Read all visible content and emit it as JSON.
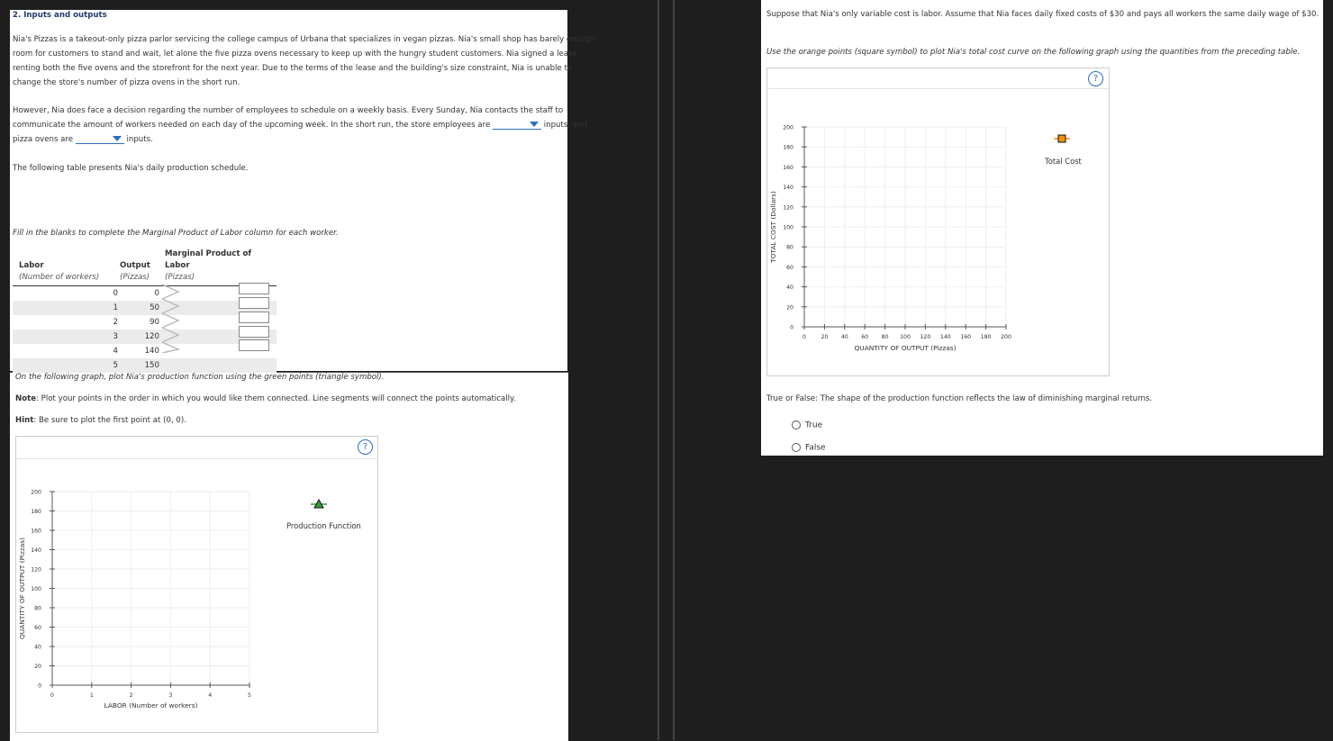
{
  "left": {
    "heading": "2. Inputs and outputs",
    "para1_lines": [
      "Nia's Pizzas is a takeout-only pizza parlor servicing the college campus of Urbana that specializes in vegan pizzas. Nia's small shop has barely enough",
      "room for customers to stand and wait, let alone the five pizza ovens necessary to keep up with the hungry student customers. Nia signed a lease",
      "renting both the five ovens and the storefront for the next year. Due to the terms of the lease and the building's size constraint, Nia is unable to",
      "change the store's number of pizza ovens in the short run."
    ],
    "para2_line1": "However, Nia does face a decision regarding the number of employees to schedule on a weekly basis. Every Sunday, Nia contacts the staff to",
    "para2_line2_a": "communicate the amount of workers needed on each day of the upcoming week. In the short run, the store employees are",
    "para2_line2_b": "inputs, and",
    "para2_line3_a": "pizza ovens are",
    "para2_line3_b": "inputs.",
    "para3": "The following table presents Nia's daily production schedule.",
    "fill_instruction": "Fill in the blanks to complete the Marginal Product of Labor column for each worker.",
    "table": {
      "headers": [
        {
          "line1": "Labor",
          "line2": "(Number of workers)"
        },
        {
          "line1": "Output",
          "line2": "(Pizzas)"
        },
        {
          "line1": "Marginal Product of Labor",
          "line2": "(Pizzas)"
        }
      ],
      "rows": [
        {
          "labor": "0",
          "output": "0"
        },
        {
          "labor": "1",
          "output": "50"
        },
        {
          "labor": "2",
          "output": "90"
        },
        {
          "labor": "3",
          "output": "120"
        },
        {
          "labor": "4",
          "output": "140"
        },
        {
          "labor": "5",
          "output": "150"
        }
      ]
    },
    "graph_instruction": "On the following graph, plot Nia's production function using the green points (triangle symbol).",
    "note_label": "Note",
    "note_text": ": Plot your points in the order in which you would like them connected. Line segments will connect the points automatically.",
    "hint_label": "Hint",
    "hint_text": ": Be sure to plot the first point at (0, 0).",
    "help_symbol": "?",
    "legend_label": "Production Function"
  },
  "right": {
    "para1": "Suppose that Nia's only variable cost is labor. Assume that Nia faces daily fixed costs of $30 and pays all workers the same daily wage of $30.",
    "para2": "Use the orange points (square symbol) to plot Nia's total cost curve on the following graph using the quantities from the preceding table.",
    "help_symbol": "?",
    "legend_label": "Total Cost",
    "question": "True or False: The shape of the production function reflects the law of diminishing marginal returns.",
    "options": [
      "True",
      "False"
    ]
  },
  "chart_data": [
    {
      "type": "scatter",
      "title": "",
      "xlabel": "LABOR (Number of workers)",
      "ylabel": "QUANTITY OF OUTPUT (Pizzas)",
      "xlim": [
        0,
        5
      ],
      "ylim": [
        0,
        200
      ],
      "x_ticks": [
        0,
        1,
        2,
        3,
        4,
        5
      ],
      "y_ticks": [
        0,
        20,
        40,
        60,
        80,
        100,
        120,
        140,
        160,
        180,
        200
      ],
      "grid": true,
      "legend": [
        {
          "name": "Production Function",
          "marker": "triangle",
          "color": "#3a9a3a"
        }
      ],
      "series": []
    },
    {
      "type": "scatter",
      "title": "",
      "xlabel": "QUANTITY OF OUTPUT (Pizzas)",
      "ylabel": "TOTAL COST (Dollars)",
      "xlim": [
        0,
        200
      ],
      "ylim": [
        0,
        200
      ],
      "x_ticks": [
        0,
        20,
        40,
        60,
        80,
        100,
        120,
        140,
        160,
        180,
        200
      ],
      "y_ticks": [
        0,
        20,
        40,
        60,
        80,
        100,
        120,
        140,
        160,
        180,
        200
      ],
      "grid": true,
      "legend": [
        {
          "name": "Total Cost",
          "marker": "square",
          "color": "#f0900c"
        }
      ],
      "series": []
    }
  ]
}
